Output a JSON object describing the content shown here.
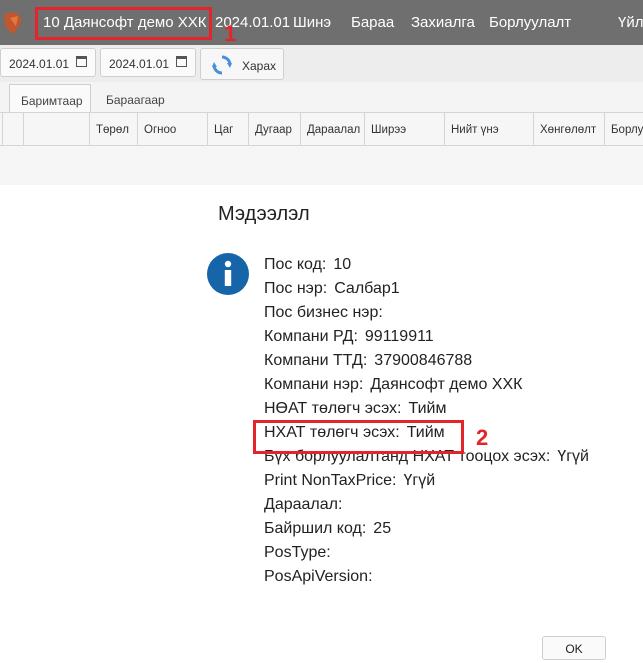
{
  "header": {
    "company": "10 Даянсофт демо ХХК",
    "date": "2024.01.01",
    "menu": [
      "Шинэ",
      "Бараа",
      "Захиалга",
      "Борлуулалт",
      "Үйл"
    ]
  },
  "toolbar": {
    "date_from": "2024.01.01",
    "date_to": "2024.01.01",
    "view_label": "Харах"
  },
  "tabs": [
    "Баримтаар",
    "Бараагаар"
  ],
  "grid": {
    "columns": [
      "Төрөл",
      "Огноо",
      "Цаг",
      "Дугаар",
      "Дараалал",
      "Ширээ",
      "Нийт үнэ",
      "Хөнгөлөлт",
      "Борлу"
    ]
  },
  "dialog": {
    "title": "Мэдээлэл",
    "icon": "info-icon",
    "fields": [
      {
        "label": "Пос код:",
        "value": "10"
      },
      {
        "label": "Пос нэр:",
        "value": "Салбар1"
      },
      {
        "label": "Пос бизнес нэр:",
        "value": ""
      },
      {
        "label": "Компани РД:",
        "value": "99119911"
      },
      {
        "label": "Компани ТТД:",
        "value": "37900846788"
      },
      {
        "label": "Компани нэр:",
        "value": "Даянсофт демо ХХК"
      },
      {
        "label": "НӨАТ төлөгч эсэх:",
        "value": "Тийм"
      },
      {
        "label": "НХАТ төлөгч эсэх:",
        "value": "Тийм"
      },
      {
        "label": "Бүх борлуулалтанд НХАТ тооцох эсэх:",
        "value": "Үгүй"
      },
      {
        "label": "Print NonTaxPrice:",
        "value": "Үгүй"
      },
      {
        "label": "Дараалал:",
        "value": ""
      },
      {
        "label": "Байршил код:",
        "value": "25"
      },
      {
        "label": "PosType:",
        "value": ""
      },
      {
        "label": "PosApiVersion:",
        "value": ""
      }
    ],
    "ok_label": "OK"
  },
  "annotations": [
    "1",
    "2"
  ],
  "colors": {
    "highlight": "#e3242b",
    "titlebar": "#6f6f6f",
    "info": "#1565a8"
  }
}
